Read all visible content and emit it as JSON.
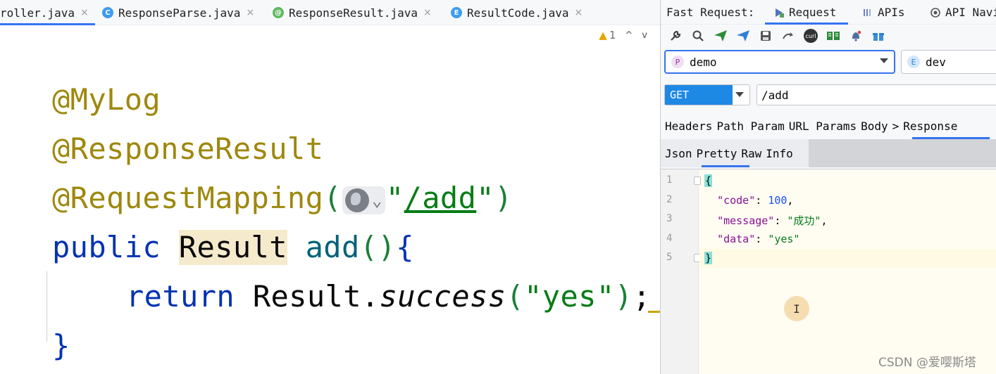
{
  "editor_tabs": [
    {
      "label": "roller.java",
      "icon": "class-icon",
      "icon_letter": "",
      "icon_color": "#3574f0"
    },
    {
      "label": "ResponseParse.java",
      "icon": "class-icon",
      "icon_letter": "C",
      "icon_color": "#3d9bf0"
    },
    {
      "label": "ResponseResult.java",
      "icon": "annotation-icon",
      "icon_letter": "@",
      "icon_color": "#5fb85f"
    },
    {
      "label": "ResultCode.java",
      "icon": "enum-icon",
      "icon_letter": "E",
      "icon_color": "#3d9bf0"
    }
  ],
  "tab_close": "×",
  "inspections": {
    "warning_icon": "▲",
    "count": "1",
    "up": "^",
    "down": "v"
  },
  "code": {
    "l1": "@MyLog",
    "l2": "@ResponseResult",
    "l3_ann": "@RequestMapping",
    "l3_open": "(",
    "l3_q1": "\"",
    "l3_path": "/add",
    "l3_q2": "\"",
    "l3_close": ")",
    "l4_kw": "public",
    "l4_type": "Result",
    "l4_fn": "add",
    "l4_parens": "()",
    "l4_brace": "{",
    "l5_kw": "return",
    "l5_cls": "Result.",
    "l5_method": "success",
    "l5_open": "(",
    "l5_str": "\"yes\"",
    "l5_close": ")",
    "l5_semi": ";",
    "l6": "}"
  },
  "panel": {
    "title": "Fast Request:",
    "tabs": {
      "request": "Request",
      "apis": "APIs",
      "nav": "API Navi"
    },
    "project": {
      "badge": "P",
      "value": "demo"
    },
    "env": {
      "badge": "E",
      "value": "dev"
    },
    "method": "GET",
    "url": "/add",
    "sections": [
      "Headers",
      "Path Param",
      "URL Params",
      "Body",
      ">",
      "Response"
    ],
    "response_tabs": [
      "Json",
      "Pretty",
      "Raw",
      "Info"
    ],
    "toolbar_icons": [
      "wrench-icon",
      "search-icon",
      "send-icon",
      "send-download-icon",
      "save-icon",
      "redo-icon",
      "curl-icon",
      "docs-icon",
      "bell-icon",
      "gift-icon"
    ],
    "curl_label": "curl"
  },
  "json_response": {
    "line_numbers": [
      "1",
      "2",
      "3",
      "4",
      "5"
    ],
    "open_brace": "{",
    "close_brace": "}",
    "code_key": "\"code\"",
    "code_value": "100",
    "message_key": "\"message\"",
    "message_value": "\"成功\"",
    "data_key": "\"data\"",
    "data_value": "\"yes\"",
    "colon": ": ",
    "comma": ","
  },
  "cursor": "I",
  "watermark": "CSDN @爱嘤斯塔"
}
